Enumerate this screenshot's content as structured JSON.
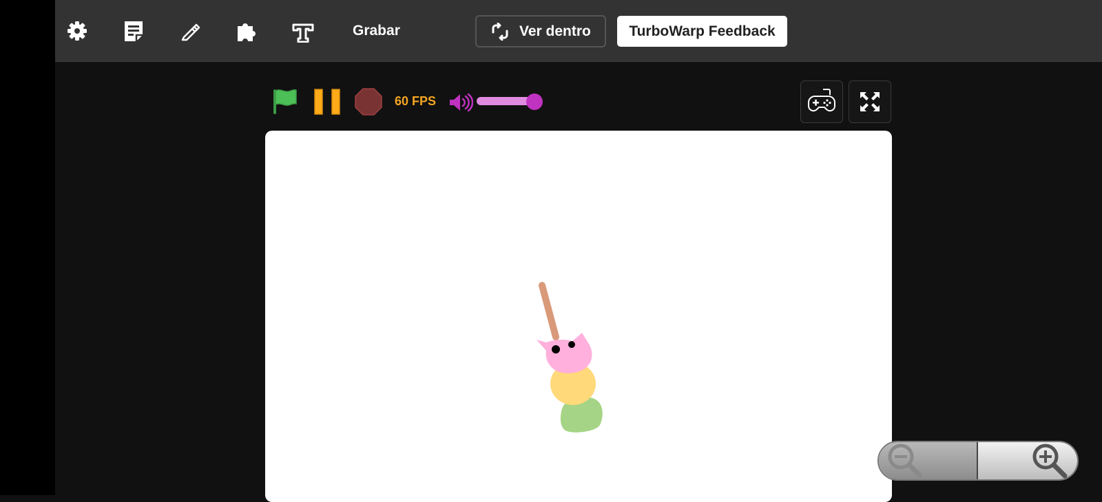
{
  "toolbar": {
    "icons": [
      "gear-icon",
      "notes-icon",
      "pencil-icon",
      "puzzle-icon",
      "turbowarp-logo-icon"
    ],
    "record_label": "Grabar",
    "see_inside_label": "Ver dentro",
    "feedback_label": "TurboWarp Feedback"
  },
  "controls": {
    "fps_label": "60 FPS",
    "volume_level_fraction": 1.0,
    "colors": {
      "flag": "#4cbf56",
      "pause": "#ffab19",
      "stop": "#7a3333",
      "fps": "#f5a623",
      "volume": "#c032c0"
    }
  },
  "stage_controls": {
    "icons": [
      "gamepad-icon",
      "fullscreen-icon"
    ]
  },
  "stage": {
    "sprite": "dango-cat-skewer"
  },
  "zoom": {
    "icons": [
      "zoom-out-icon",
      "zoom-in-icon"
    ]
  }
}
